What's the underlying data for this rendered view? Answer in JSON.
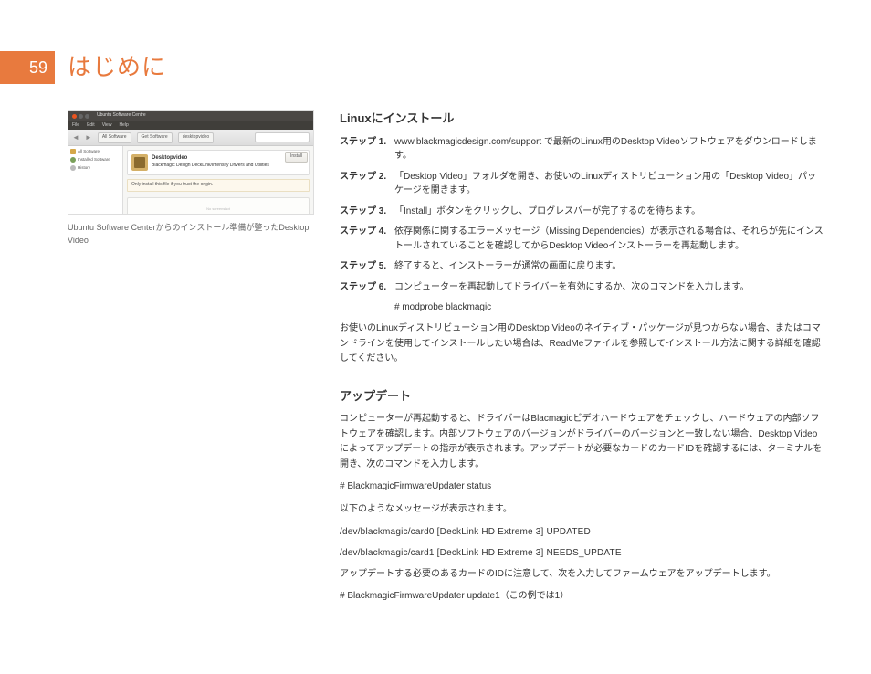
{
  "page_number": "59",
  "page_title": "はじめに",
  "figure": {
    "window_title": "Ubuntu Software Centre",
    "menu": [
      "File",
      "Edit",
      "View",
      "Help"
    ],
    "crumb1": "All Software",
    "crumb2": "Get Software",
    "crumb3": "desktopvideo",
    "left": {
      "all": "All Software",
      "installed": "Installed Software",
      "history": "History"
    },
    "card_title": "Desktopvideo",
    "card_sub": "Blackmagic Design DeckLink/Intensity Drivers and Utilities",
    "install_btn": "Install",
    "note": "Only install this file if you trust the origin.",
    "blank": "No screenshot"
  },
  "caption": "Ubuntu Software Centerからのインストール準備が整ったDesktop Video",
  "linux_install": {
    "heading": "Linuxにインストール",
    "steps": [
      {
        "label": "ステップ 1.",
        "text": "www.blackmagicdesign.com/support で最新のLinux用のDesktop Videoソフトウェアをダウンロードします。"
      },
      {
        "label": "ステップ 2.",
        "text": "「Desktop Video」フォルダを開き、お使いのLinuxディストリビューション用の「Desktop Video」パッケージを開きます。"
      },
      {
        "label": "ステップ 3.",
        "text": "「Install」ボタンをクリックし、プログレスバーが完了するのを待ちます。"
      },
      {
        "label": "ステップ 4.",
        "text": "依存関係に関するエラーメッセージ（Missing Dependencies）が表示される場合は、それらが先にインストールされていることを確認してからDesktop Videoインストーラーを再起動します。"
      },
      {
        "label": "ステップ 5.",
        "text": "終了すると、インストーラーが通常の画面に戻ります。"
      },
      {
        "label": "ステップ 6.",
        "text": "コンピューターを再起動してドライバーを有効にするか、次のコマンドを入力します。"
      }
    ],
    "cmd": "# modprobe blackmagic",
    "after": "お使いのLinuxディストリビューション用のDesktop Videoのネイティブ・パッケージが見つからない場合、またはコマンドラインを使用してインストールしたい場合は、ReadMeファイルを参照してインストール方法に関する詳細を確認してください。"
  },
  "update": {
    "heading": "アップデート",
    "intro": "コンピューターが再起動すると、ドライバーはBlacmagicビデオハードウェアをチェックし、ハードウェアの内部ソフトウェアを確認します。内部ソフトウェアのバージョンがドライバーのバージョンと一致しない場合、Desktop Videoによってアップデートの指示が表示されます。アップデートが必要なカードのカードIDを確認するには、ターミナルを開き、次のコマンドを入力します。",
    "cmd_status": "# BlackmagicFirmwareUpdater status",
    "message_intro": "以下のようなメッセージが表示されます。",
    "dev0": "/dev/blackmagic/card0    [DeckLink HD Extreme 3] UPDATED",
    "dev1": "/dev/blackmagic/card1    [DeckLink HD Extreme 3] NEEDS_UPDATE",
    "update_note": "アップデートする必要のあるカードのIDに注意して、次を入力してファームウェアをアップデートします。",
    "cmd_update": "# BlackmagicFirmwareUpdater update1（この例では1）"
  }
}
